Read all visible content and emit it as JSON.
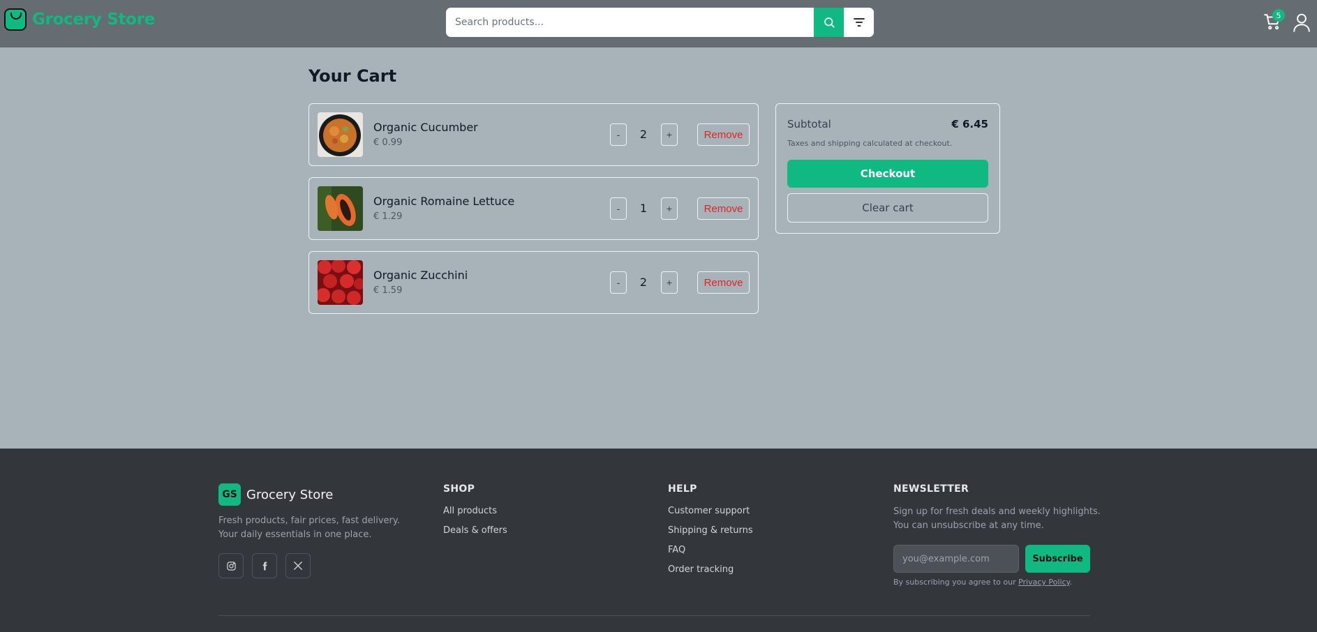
{
  "header": {
    "logo_text": "Grocery Store",
    "search_placeholder": "Search products...",
    "cart_count": "5",
    "accent_color": "#10b981",
    "icons": [
      "shopping-bag-icon",
      "search-icon",
      "filter-icon",
      "cart-icon",
      "user-icon"
    ]
  },
  "cart": {
    "title": "Your Cart",
    "items": [
      {
        "name": "Organic Cucumber",
        "price": "€ 0.99",
        "qty": "2",
        "minus": "-",
        "plus": "+",
        "remove": "Remove",
        "image": "paella-dish"
      },
      {
        "name": "Organic Romaine Lettuce",
        "price": "€ 1.29",
        "qty": "1",
        "minus": "-",
        "plus": "+",
        "remove": "Remove",
        "image": "papaya"
      },
      {
        "name": "Organic Zucchini",
        "price": "€ 1.59",
        "qty": "2",
        "minus": "-",
        "plus": "+",
        "remove": "Remove",
        "image": "strawberries"
      }
    ]
  },
  "summary": {
    "subtotal_label": "Subtotal",
    "subtotal_value": "€ 6.45",
    "tax_note": "Taxes and shipping calculated at checkout.",
    "checkout_label": "Checkout",
    "clear_label": "Clear cart"
  },
  "footer": {
    "badge": "GS",
    "brand": "Grocery Store",
    "tagline": "Fresh products, fair prices, fast delivery. Your daily essentials in one place.",
    "social": [
      "instagram-icon",
      "facebook-icon",
      "x-icon"
    ],
    "shop": {
      "title": "SHOP",
      "links": [
        "All products",
        "Deals & offers"
      ]
    },
    "help": {
      "title": "HELP",
      "links": [
        "Customer support",
        "Shipping & returns",
        "FAQ",
        "Order tracking"
      ]
    },
    "newsletter": {
      "title": "NEWSLETTER",
      "text": "Sign up for fresh deals and weekly highlights. You can unsubscribe at any time.",
      "email_placeholder": "you@example.com",
      "subscribe_label": "Subscribe",
      "agree_text": "By subscribing you agree to our",
      "privacy_link": "Privacy Policy",
      "agree_end": "."
    }
  }
}
